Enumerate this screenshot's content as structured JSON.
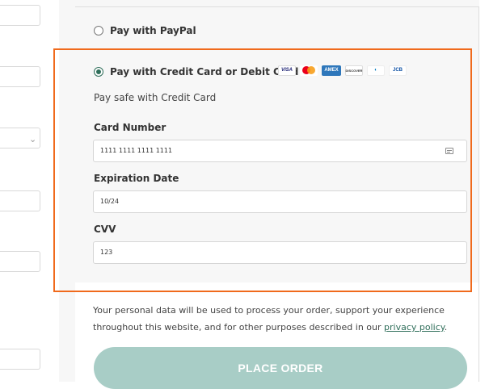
{
  "payment": {
    "paypal_label": "Pay with PayPal",
    "credit_label": "Pay with Credit Card or Debit Card",
    "credit_subtext": "Pay safe with Credit Card",
    "selected": "credit"
  },
  "card_logos": [
    "VISA",
    "mastercard",
    "AMEX",
    "DISCOVER",
    "diners",
    "JCB"
  ],
  "fields": {
    "card_number": {
      "label": "Card Number",
      "value": "1111 1111 1111 1111"
    },
    "expiration": {
      "label": "Expiration Date",
      "value": "10/24"
    },
    "cvv": {
      "label": "CVV",
      "value": "123"
    }
  },
  "privacy": {
    "text": "Your personal data will be used to process your order, support your experience throughout this website, and for other purposes described in our ",
    "link": "privacy policy",
    "suffix": "."
  },
  "place_order_label": "PLACE ORDER",
  "colors": {
    "accent": "#2f6e5a",
    "highlight": "#f06a1c",
    "button": "#a8cdc6"
  }
}
